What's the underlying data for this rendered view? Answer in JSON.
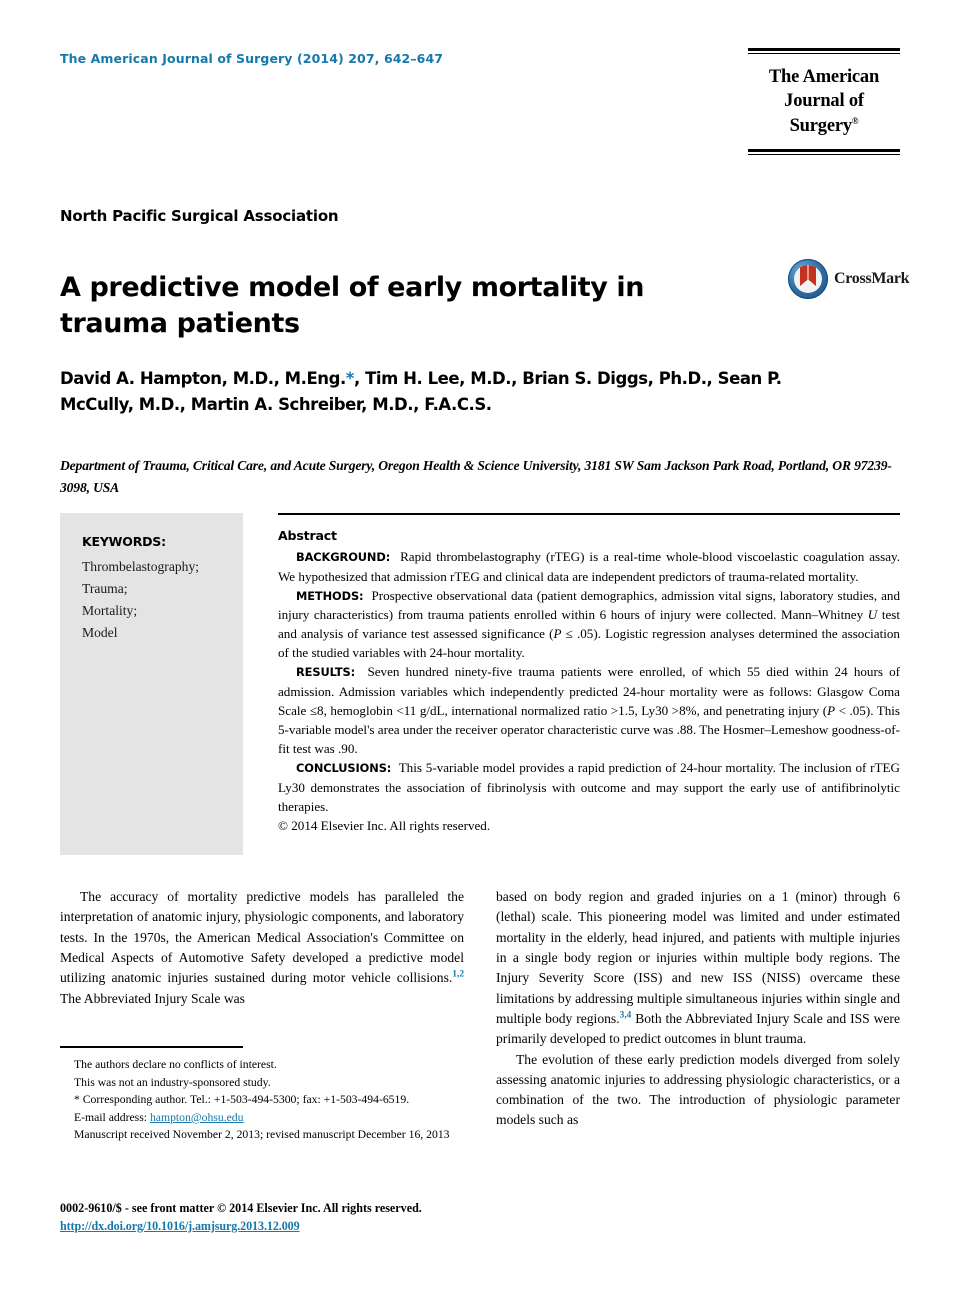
{
  "masthead": {
    "journal_reference": "The American Journal of Surgery (2014) 207, 642–647",
    "logo_line1": "The American",
    "logo_line2": "Journal of Surgery",
    "logo_registered": "®",
    "accent_color": "#1579ab"
  },
  "article": {
    "society": "North Pacific Surgical Association",
    "title": "A predictive model of early mortality in trauma patients",
    "crossmark_label": "CrossMark",
    "authors": "David A. Hampton, M.D., M.Eng.*, Tim H. Lee, M.D., Brian S. Diggs, Ph.D., Sean P. McCully, M.D., Martin A. Schreiber, M.D., F.A.C.S.",
    "affiliation": "Department of Trauma, Critical Care, and Acute Surgery, Oregon Health & Science University, 3181 SW Sam Jackson Park Road, Portland, OR 97239-3098, USA"
  },
  "keywords": {
    "heading": "KEYWORDS:",
    "items": [
      "Thrombelastography;",
      "Trauma;",
      "Mortality;",
      "Model"
    ]
  },
  "abstract": {
    "heading": "Abstract",
    "background_label": "BACKGROUND:",
    "background_text": "Rapid thrombelastography (rTEG) is a real-time whole-blood viscoelastic coagulation assay. We hypothesized that admission rTEG and clinical data are independent predictors of trauma-related mortality.",
    "methods_label": "METHODS:",
    "methods_text_1": "Prospective observational data (patient demographics, admission vital signs, laboratory studies, and injury characteristics) from trauma patients enrolled within 6 hours of injury were collected. Mann–Whitney ",
    "methods_italic_u": "U",
    "methods_text_2": " test and analysis of variance test assessed significance (",
    "methods_italic_p": "P",
    "methods_text_3": " ≤ .05). Logistic regression analyses determined the association of the studied variables with 24-hour mortality.",
    "results_label": "RESULTS:",
    "results_text_1": "Seven hundred ninety-five trauma patients were enrolled, of which 55 died within 24 hours of admission. Admission variables which independently predicted 24-hour mortality were as follows: Glasgow Coma Scale ≤8, hemoglobin <11 g/dL, international normalized ratio >1.5, Ly30 >8%, and penetrating injury (",
    "results_italic_p": "P",
    "results_text_2": " < .05). This 5-variable model's area under the receiver operator characteristic curve was .88. The Hosmer–Lemeshow goodness-of-fit test was .90.",
    "conclusions_label": "CONCLUSIONS:",
    "conclusions_text": "This 5-variable model provides a rapid prediction of 24-hour mortality. The inclusion of rTEG Ly30 demonstrates the association of fibrinolysis with outcome and may support the early use of antifibrinolytic therapies.",
    "copyright": "© 2014 Elsevier Inc. All rights reserved."
  },
  "body": {
    "left_p1_part1": "The accuracy of mortality predictive models has paralleled the interpretation of anatomic injury, physiologic components, and laboratory tests. In the 1970s, the American Medical Association's Committee on Medical Aspects of Automotive Safety developed a predictive model utilizing anatomic injuries sustained during motor vehicle collisions.",
    "left_p1_cite": "1,2",
    "left_p1_part2": " The Abbreviated Injury Scale was",
    "right_p1_part1": "based on body region and graded injuries on a 1 (minor) through 6 (lethal) scale. This pioneering model was limited and under estimated mortality in the elderly, head injured, and patients with multiple injuries in a single body region or injuries within multiple body regions. The Injury Severity Score (ISS) and new ISS (NISS) overcame these limitations by addressing multiple simultaneous injuries within single and multiple body regions.",
    "right_p1_cite": "3,4",
    "right_p1_part2": " Both the Abbreviated Injury Scale and ISS were primarily developed to predict outcomes in blunt trauma.",
    "right_p2": "The evolution of these early prediction models diverged from solely assessing anatomic injuries to addressing physiologic characteristics, or a combination of the two. The introduction of physiologic parameter models such as"
  },
  "footnotes": {
    "line1": "The authors declare no conflicts of interest.",
    "line2": "This was not an industry-sponsored study.",
    "line3": "* Corresponding author. Tel.: +1-503-494-5300; fax: +1-503-494-6519.",
    "email_label": "E-mail address:",
    "email": "hampton@ohsu.edu",
    "line5": "Manuscript received November 2, 2013; revised manuscript December 16, 2013"
  },
  "footer": {
    "issn_line": "0002-9610/$ - see front matter © 2014 Elsevier Inc. All rights reserved.",
    "doi": "http://dx.doi.org/10.1016/j.amjsurg.2013.12.009"
  }
}
